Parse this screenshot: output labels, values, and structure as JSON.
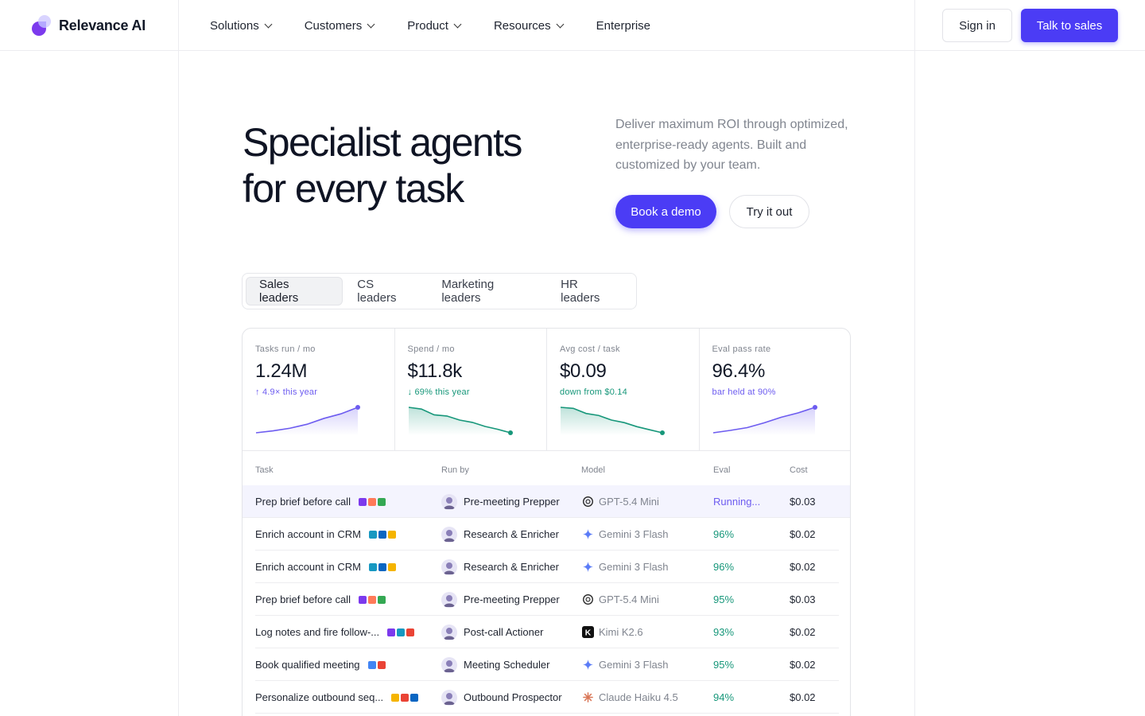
{
  "brand": {
    "name": "Relevance AI"
  },
  "nav": {
    "items": [
      {
        "label": "Solutions",
        "dropdown": true
      },
      {
        "label": "Customers",
        "dropdown": true
      },
      {
        "label": "Product",
        "dropdown": true
      },
      {
        "label": "Resources",
        "dropdown": true
      },
      {
        "label": "Enterprise",
        "dropdown": false
      }
    ],
    "sign_in": "Sign in",
    "talk_to_sales": "Talk to sales"
  },
  "hero": {
    "title_line1": "Specialist agents",
    "title_line2": "for every task",
    "description": "Deliver maximum ROI through optimized, enterprise-ready agents. Built and customized by your team.",
    "primary_cta": "Book a demo",
    "secondary_cta": "Try it out"
  },
  "tabs": [
    {
      "label": "Sales leaders",
      "active": true
    },
    {
      "label": "CS leaders",
      "active": false
    },
    {
      "label": "Marketing leaders",
      "active": false
    },
    {
      "label": "HR leaders",
      "active": false
    }
  ],
  "metrics": [
    {
      "label": "Tasks run / mo",
      "value": "1.24M",
      "delta": "↑ 4.9× this year",
      "tone": "purple",
      "trend": [
        1,
        1.3,
        1.7,
        2.3,
        3.2,
        3.9,
        4.9
      ]
    },
    {
      "label": "Spend / mo",
      "value": "$11.8k",
      "delta": "↓ 69% this year",
      "tone": "green",
      "trend": [
        10,
        9.4,
        7.4,
        7,
        5.6,
        4.8,
        3.4,
        2.4,
        1.2
      ]
    },
    {
      "label": "Avg cost / task",
      "value": "$0.09",
      "delta": "down from $0.14",
      "tone": "green",
      "trend": [
        0.14,
        0.138,
        0.128,
        0.124,
        0.115,
        0.11,
        0.102,
        0.096,
        0.09
      ]
    },
    {
      "label": "Eval pass rate",
      "value": "96.4%",
      "delta": "bar held at 90%",
      "tone": "purple",
      "trend": [
        90,
        90.6,
        91.3,
        92.5,
        93.9,
        95,
        96.4
      ]
    }
  ],
  "table": {
    "headers": {
      "task": "Task",
      "run_by": "Run by",
      "model": "Model",
      "eval": "Eval",
      "cost": "Cost"
    },
    "rows": [
      {
        "task": "Prep brief before call",
        "tools": [
          "#7c3aed",
          "#ff7a59",
          "#34a853"
        ],
        "run_by": "Pre-meeting Prepper",
        "model": "GPT-5.4 Mini",
        "model_icon": "openai-icon",
        "eval": "Running...",
        "eval_state": "running",
        "cost": "$0.03"
      },
      {
        "task": "Enrich account in CRM",
        "tools": [
          "#1798c1",
          "#0a66c2",
          "#f5b400"
        ],
        "run_by": "Research & Enricher",
        "model": "Gemini 3 Flash",
        "model_icon": "gemini-icon",
        "eval": "96%",
        "eval_state": "ok",
        "cost": "$0.02"
      },
      {
        "task": "Enrich account in CRM",
        "tools": [
          "#1798c1",
          "#0a66c2",
          "#f5b400"
        ],
        "run_by": "Research & Enricher",
        "model": "Gemini 3 Flash",
        "model_icon": "gemini-icon",
        "eval": "96%",
        "eval_state": "ok",
        "cost": "$0.02"
      },
      {
        "task": "Prep brief before call",
        "tools": [
          "#7c3aed",
          "#ff7a59",
          "#34a853"
        ],
        "run_by": "Pre-meeting Prepper",
        "model": "GPT-5.4 Mini",
        "model_icon": "openai-icon",
        "eval": "95%",
        "eval_state": "ok",
        "cost": "$0.03"
      },
      {
        "task": "Log notes and fire follow-...",
        "tools": [
          "#7c3aed",
          "#1798c1",
          "#ea4335"
        ],
        "run_by": "Post-call Actioner",
        "model": "Kimi K2.6",
        "model_icon": "kimi-icon",
        "eval": "93%",
        "eval_state": "ok",
        "cost": "$0.02"
      },
      {
        "task": "Book qualified meeting",
        "tools": [
          "#4285f4",
          "#ea4335"
        ],
        "run_by": "Meeting Scheduler",
        "model": "Gemini 3 Flash",
        "model_icon": "gemini-icon",
        "eval": "95%",
        "eval_state": "ok",
        "cost": "$0.02"
      },
      {
        "task": "Personalize outbound seq...",
        "tools": [
          "#f5b400",
          "#ea4335",
          "#0a66c2"
        ],
        "run_by": "Outbound Prospector",
        "model": "Claude Haiku 4.5",
        "model_icon": "claude-icon",
        "eval": "94%",
        "eval_state": "ok",
        "cost": "$0.02"
      }
    ]
  },
  "colors": {
    "accent": "#4b3cf5",
    "purple_text": "#6d5cf0",
    "green_text": "#17977a",
    "muted": "#80858f"
  }
}
